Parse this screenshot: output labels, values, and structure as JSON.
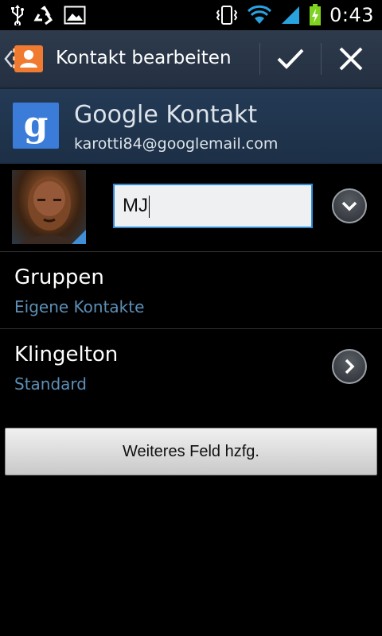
{
  "status_bar": {
    "time": "0:43",
    "icons": [
      "usb-icon",
      "recycle-icon",
      "gallery-icon",
      "vibrate-icon",
      "wifi-icon",
      "signal-icon",
      "battery-charging-icon"
    ],
    "colors": {
      "wifi": "#2aa2e0",
      "battery": "#7ed321"
    }
  },
  "action_bar": {
    "title": "Kontakt bearbeiten",
    "back_icon": "contacts-app-icon",
    "confirm_icon": "checkmark-icon",
    "cancel_icon": "close-icon"
  },
  "account": {
    "logo_letter": "g",
    "title": "Google Kontakt",
    "email": "karotti84@googlemail.com"
  },
  "name": {
    "value": "MJ"
  },
  "groups": {
    "label": "Gruppen",
    "value": "Eigene Kontakte"
  },
  "ringtone": {
    "label": "Klingelton",
    "value": "Standard"
  },
  "add_field": {
    "label": "Weiteres Feld hzfg."
  },
  "colors": {
    "accent": "#2f8ad3",
    "secondary_text": "#5c8fb6"
  }
}
